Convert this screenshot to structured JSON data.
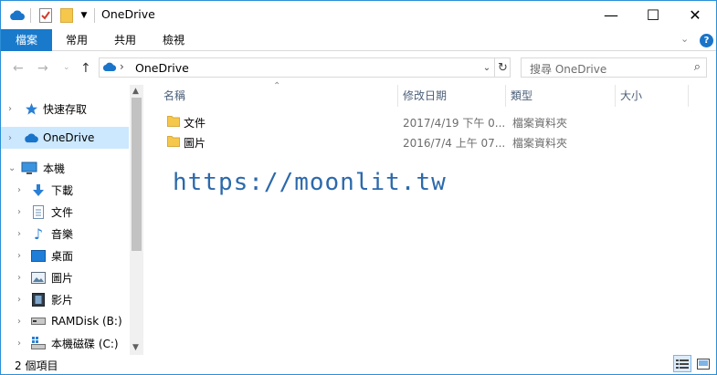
{
  "window": {
    "title": "OneDrive",
    "controls": {
      "minimize": "—",
      "maximize": "☐",
      "close": "✕"
    }
  },
  "ribbon": {
    "tabs": [
      {
        "label": "檔案",
        "active": true
      },
      {
        "label": "常用",
        "active": false
      },
      {
        "label": "共用",
        "active": false
      },
      {
        "label": "檢視",
        "active": false
      }
    ],
    "help": "?"
  },
  "address": {
    "path": "OneDrive",
    "separator": "›"
  },
  "search": {
    "placeholder": "搜尋 OneDrive"
  },
  "nav": {
    "items": [
      {
        "label": "快速存取",
        "icon": "star-pin-icon",
        "selected": false
      },
      {
        "label": "OneDrive",
        "icon": "onedrive-cloud-icon",
        "selected": true
      },
      {
        "label": "本機",
        "icon": "computer-icon",
        "selected": false
      },
      {
        "label": "下載",
        "icon": "download-arrow-icon",
        "selected": false
      },
      {
        "label": "文件",
        "icon": "document-icon",
        "selected": false
      },
      {
        "label": "音樂",
        "icon": "music-note-icon",
        "selected": false
      },
      {
        "label": "桌面",
        "icon": "desktop-icon",
        "selected": false
      },
      {
        "label": "圖片",
        "icon": "picture-icon",
        "selected": false
      },
      {
        "label": "影片",
        "icon": "film-icon",
        "selected": false
      },
      {
        "label": "RAMDisk (B:)",
        "icon": "drive-icon",
        "selected": false
      },
      {
        "label": "本機磁碟 (C:)",
        "icon": "system-drive-icon",
        "selected": false
      }
    ]
  },
  "columns": {
    "name": "名稱",
    "modified": "修改日期",
    "type": "類型",
    "size": "大小"
  },
  "files": [
    {
      "name": "文件",
      "modified": "2017/4/19 下午 0...",
      "type": "檔案資料夾",
      "size": ""
    },
    {
      "name": "圖片",
      "modified": "2016/7/4 上午 07...",
      "type": "檔案資料夾",
      "size": ""
    }
  ],
  "watermark": "https://moonlit.tw",
  "status": {
    "count": "2 個項目"
  },
  "colors": {
    "accent": "#1979ca",
    "selection": "#cce8ff",
    "folder": "#f5c84c",
    "watermark": "#2c69ab"
  }
}
